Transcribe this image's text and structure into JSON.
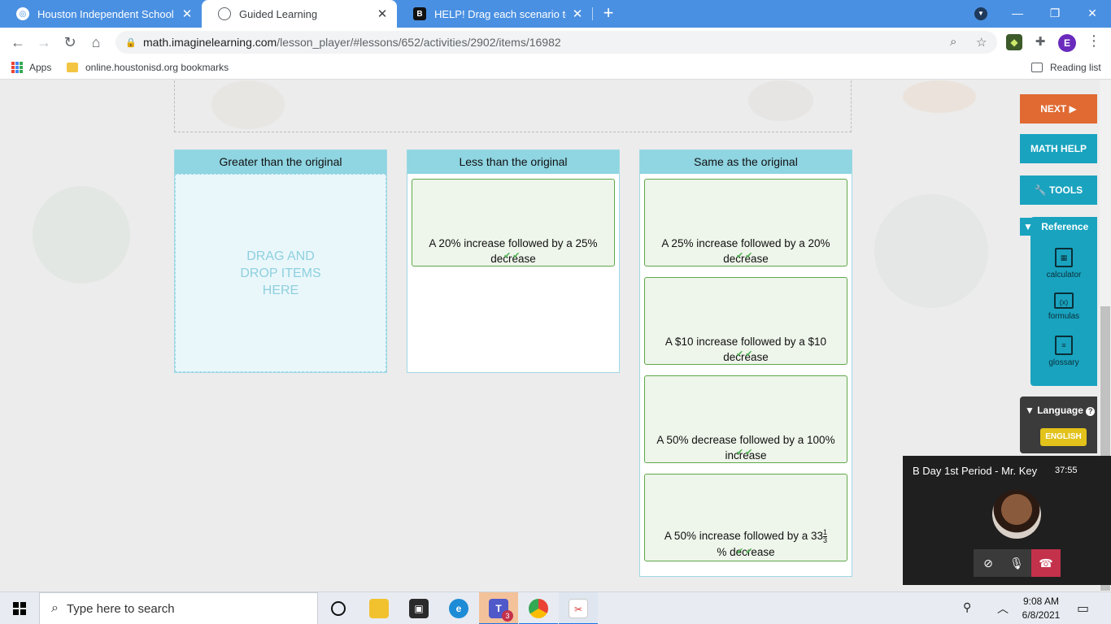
{
  "browser": {
    "tabs": [
      {
        "title": "Houston Independent School Dis",
        "icon": "houston-isd-favicon"
      },
      {
        "title": "Guided Learning",
        "icon": "globe-icon"
      },
      {
        "title": "HELP! Drag each scenario to sho",
        "icon": "brainly-favicon"
      }
    ],
    "url_host": "math.imaginelearning.com",
    "url_path": "/lesson_player/#lessons/652/activities/2902/items/16982",
    "profile_initial": "E",
    "bookmarks": {
      "apps_label": "Apps",
      "folder_label": "online.houstonisd.org bookmarks",
      "reading_list_label": "Reading list"
    }
  },
  "activity": {
    "columns": [
      {
        "header": "Greater than the original",
        "drop_hint": [
          "DRAG AND",
          "DROP ITEMS",
          "HERE"
        ]
      },
      {
        "header": "Less than the original"
      },
      {
        "header": "Same as the original"
      }
    ],
    "cards_less": [
      {
        "text": "A 20% increase followed by a 25% decrease"
      }
    ],
    "cards_same": [
      {
        "text": "A 25% increase followed by a 20% decrease"
      },
      {
        "text": "A $10 increase followed by a $10 decrease"
      },
      {
        "text": "A 50% decrease followed by a 100% increase"
      },
      {
        "text_before": "A 50% increase followed by a 33",
        "frac_num": "1",
        "frac_den": "3",
        "text_after": "% decrease"
      }
    ]
  },
  "sidebar": {
    "next_label": "NEXT ▶",
    "math_help_label": "MATH HELP",
    "tools_label": "🔧 TOOLS",
    "reference_label": "Reference",
    "tools": [
      {
        "label": "calculator",
        "icon": "calculator-icon"
      },
      {
        "label": "formulas",
        "icon": "formulas-icon"
      },
      {
        "label": "glossary",
        "icon": "glossary-icon"
      }
    ],
    "language_label": "Language",
    "language_value": "ENGLISH",
    "colors": {
      "next": "#e06a32",
      "help": "#19a3bf",
      "reference": "#19a3bf"
    }
  },
  "teams": {
    "meeting_title": "B Day 1st Period - Mr. Key",
    "timer": "37:55"
  },
  "taskbar": {
    "search_placeholder": "Type here to search",
    "teams_badge": "3",
    "time": "9:08 AM",
    "date": "6/8/2021"
  }
}
